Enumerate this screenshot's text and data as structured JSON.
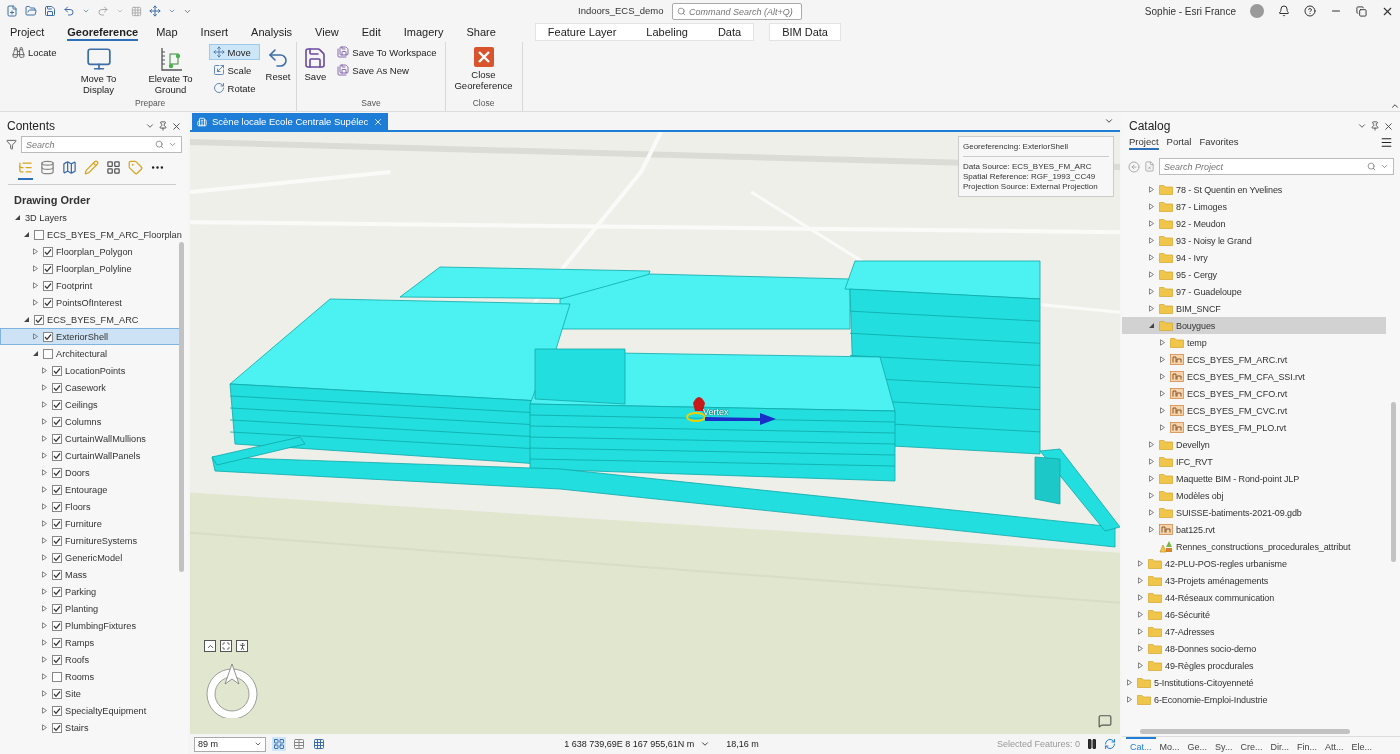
{
  "window": {
    "title": "Indoors_ECS_demo",
    "command_search": {
      "placeholder": "Command Search (Alt+Q)"
    },
    "user": "Sophie - Esri France"
  },
  "ribbon_tabs": [
    {
      "label": "Project",
      "selected": false
    },
    {
      "label": "Georeference",
      "selected": true
    },
    {
      "label": "Map",
      "selected": false
    },
    {
      "label": "Insert",
      "selected": false
    },
    {
      "label": "Analysis",
      "selected": false
    },
    {
      "label": "View",
      "selected": false
    },
    {
      "label": "Edit",
      "selected": false
    },
    {
      "label": "Imagery",
      "selected": false
    },
    {
      "label": "Share",
      "selected": false
    }
  ],
  "contextual_tabs": [
    "Feature Layer",
    "Labeling",
    "Data"
  ],
  "extra_tab": "BIM Data",
  "ribbon_groups": [
    {
      "label": "Prepare",
      "columns": [
        [
          {
            "label": "Locate",
            "kind": "small",
            "selected": false
          }
        ],
        [
          {
            "label": "Move To Display",
            "kind": "large",
            "selected": false
          }
        ],
        [
          {
            "label": "Elevate To Ground",
            "kind": "large",
            "selected": false
          }
        ],
        [
          {
            "label": "Move",
            "kind": "small",
            "selected": true
          },
          {
            "label": "Scale",
            "kind": "small",
            "selected": false
          },
          {
            "label": "Rotate",
            "kind": "small",
            "selected": false
          }
        ],
        [
          {
            "label": "Reset",
            "kind": "large",
            "selected": false
          }
        ]
      ]
    },
    {
      "label": "Save",
      "columns": [
        [
          {
            "label": "Save",
            "kind": "large",
            "selected": false
          }
        ],
        [
          {
            "label": "Save To Workspace",
            "kind": "small",
            "selected": false
          },
          {
            "label": "Save As New",
            "kind": "small",
            "selected": false
          }
        ]
      ]
    },
    {
      "label": "Close",
      "columns": [
        [
          {
            "label": "Close Georeference",
            "kind": "large",
            "selected": false
          }
        ]
      ]
    }
  ],
  "contents": {
    "title": "Contents",
    "search": {
      "placeholder": "Search"
    },
    "heading": "Drawing Order",
    "tree": [
      {
        "label": "3D Layers",
        "expanded": true,
        "selected": false,
        "children": [
          {
            "label": "ECS_BYES_FM_ARC_Floorplan",
            "expanded": true,
            "checked": false,
            "selected": false,
            "children": [
              {
                "label": "Floorplan_Polygon",
                "expanded": false,
                "checked": true,
                "selected": false
              },
              {
                "label": "Floorplan_Polyline",
                "expanded": false,
                "checked": true,
                "selected": false
              },
              {
                "label": "Footprint",
                "expanded": false,
                "checked": true,
                "selected": false
              },
              {
                "label": "PointsOfInterest",
                "expanded": false,
                "checked": true,
                "selected": false
              }
            ]
          },
          {
            "label": "ECS_BYES_FM_ARC",
            "expanded": true,
            "checked": true,
            "selected": false,
            "children": [
              {
                "label": "ExteriorShell",
                "expanded": false,
                "checked": true,
                "selected": true
              },
              {
                "label": "Architectural",
                "expanded": true,
                "checked": false,
                "selected": false,
                "children": [
                  {
                    "label": "LocationPoints",
                    "expanded": false,
                    "checked": true,
                    "selected": false
                  },
                  {
                    "label": "Casework",
                    "expanded": false,
                    "checked": true,
                    "selected": false
                  },
                  {
                    "label": "Ceilings",
                    "expanded": false,
                    "checked": true,
                    "selected": false
                  },
                  {
                    "label": "Columns",
                    "expanded": false,
                    "checked": true,
                    "selected": false
                  },
                  {
                    "label": "CurtainWallMullions",
                    "expanded": false,
                    "checked": true,
                    "selected": false
                  },
                  {
                    "label": "CurtainWallPanels",
                    "expanded": false,
                    "checked": true,
                    "selected": false
                  },
                  {
                    "label": "Doors",
                    "expanded": false,
                    "checked": true,
                    "selected": false
                  },
                  {
                    "label": "Entourage",
                    "expanded": false,
                    "checked": true,
                    "selected": false
                  },
                  {
                    "label": "Floors",
                    "expanded": false,
                    "checked": true,
                    "selected": false
                  },
                  {
                    "label": "Furniture",
                    "expanded": false,
                    "checked": true,
                    "selected": false
                  },
                  {
                    "label": "FurnitureSystems",
                    "expanded": false,
                    "checked": true,
                    "selected": false
                  },
                  {
                    "label": "GenericModel",
                    "expanded": false,
                    "checked": true,
                    "selected": false
                  },
                  {
                    "label": "Mass",
                    "expanded": false,
                    "checked": true,
                    "selected": false
                  },
                  {
                    "label": "Parking",
                    "expanded": false,
                    "checked": true,
                    "selected": false
                  },
                  {
                    "label": "Planting",
                    "expanded": false,
                    "checked": true,
                    "selected": false
                  },
                  {
                    "label": "PlumbingFixtures",
                    "expanded": false,
                    "checked": true,
                    "selected": false
                  },
                  {
                    "label": "Ramps",
                    "expanded": false,
                    "checked": true,
                    "selected": false
                  },
                  {
                    "label": "Roofs",
                    "expanded": false,
                    "checked": true,
                    "selected": false
                  },
                  {
                    "label": "Rooms",
                    "expanded": false,
                    "checked": false,
                    "selected": false
                  },
                  {
                    "label": "Site",
                    "expanded": false,
                    "checked": true,
                    "selected": false
                  },
                  {
                    "label": "SpecialtyEquipment",
                    "expanded": false,
                    "checked": true,
                    "selected": false
                  },
                  {
                    "label": "Stairs",
                    "expanded": false,
                    "checked": true,
                    "selected": false
                  }
                ]
              }
            ]
          }
        ]
      }
    ]
  },
  "map": {
    "tab": {
      "label": "Scène locale Ecole Centrale Supélec",
      "selected": true
    },
    "info_panel": {
      "title": "Georeferencing: ExteriorShell",
      "lines": [
        "Data Source: ECS_BYES_FM_ARC",
        "Spatial Reference: RGF_1993_CC49",
        "Projection Source: External Projection"
      ]
    },
    "vertex_label": "Vertex",
    "status_bar": {
      "scale": "89 m",
      "coordinates": "1 638 739,69E 8 167 955,61N m",
      "elevation": "18,16 m",
      "selected_features": "Selected Features: 0"
    }
  },
  "catalog": {
    "title": "Catalog",
    "tabs": [
      {
        "label": "Project",
        "selected": true
      },
      {
        "label": "Portal",
        "selected": false
      },
      {
        "label": "Favorites",
        "selected": false
      }
    ],
    "search": {
      "placeholder": "Search Project"
    },
    "tree": [
      {
        "children": [
          {
            "children": [
              {
                "label": "78 - St Quentin en Yvelines",
                "kind": "folder",
                "expanded": false,
                "selected": false
              },
              {
                "label": "87 - Limoges",
                "kind": "folder",
                "expanded": false,
                "selected": false
              },
              {
                "label": "92 - Meudon",
                "kind": "folder",
                "expanded": false,
                "selected": false
              },
              {
                "label": "93 - Noisy le Grand",
                "kind": "folder",
                "expanded": false,
                "selected": false
              },
              {
                "label": "94 - Ivry",
                "kind": "folder",
                "expanded": false,
                "selected": false
              },
              {
                "label": "95 - Cergy",
                "kind": "folder",
                "expanded": false,
                "selected": false
              },
              {
                "label": "97 - Guadeloupe",
                "kind": "folder",
                "expanded": false,
                "selected": false
              },
              {
                "label": "BIM_SNCF",
                "kind": "folder",
                "expanded": false,
                "selected": false
              },
              {
                "label": "Bouygues",
                "kind": "folder",
                "expanded": true,
                "selected": true,
                "children": [
                  {
                    "label": "temp",
                    "kind": "folder",
                    "expanded": false,
                    "selected": false
                  },
                  {
                    "label": "ECS_BYES_FM_ARC.rvt",
                    "kind": "revit",
                    "expanded": false,
                    "selected": false
                  },
                  {
                    "label": "ECS_BYES_FM_CFA_SSI.rvt",
                    "kind": "revit",
                    "expanded": false,
                    "selected": false
                  },
                  {
                    "label": "ECS_BYES_FM_CFO.rvt",
                    "kind": "revit",
                    "expanded": false,
                    "selected": false
                  },
                  {
                    "label": "ECS_BYES_FM_CVC.rvt",
                    "kind": "revit",
                    "expanded": false,
                    "selected": false
                  },
                  {
                    "label": "ECS_BYES_FM_PLO.rvt",
                    "kind": "revit",
                    "expanded": false,
                    "selected": false
                  }
                ]
              },
              {
                "label": "Devellyn",
                "kind": "folder",
                "expanded": false,
                "selected": false
              },
              {
                "label": "IFC_RVT",
                "kind": "folder",
                "expanded": false,
                "selected": false
              },
              {
                "label": "Maquette BIM - Rond-point JLP",
                "kind": "folder",
                "expanded": false,
                "selected": false
              },
              {
                "label": "Modèles obj",
                "kind": "folder",
                "expanded": false,
                "selected": false
              },
              {
                "label": "SUISSE-batiments-2021-09.gdb",
                "kind": "folder",
                "expanded": false,
                "selected": false
              },
              {
                "label": "bat125.rvt",
                "kind": "revit",
                "expanded": false,
                "selected": false
              },
              {
                "label": "Rennes_constructions_procedurales_attribut",
                "kind": "layer",
                "selected": false
              }
            ]
          },
          {
            "label": "42-PLU-POS-regles urbanisme",
            "kind": "folder",
            "expanded": false,
            "selected": false
          },
          {
            "label": "43-Projets aménagements",
            "kind": "folder",
            "expanded": false,
            "selected": false
          },
          {
            "label": "44-Réseaux communication",
            "kind": "folder",
            "expanded": false,
            "selected": false
          },
          {
            "label": "46-Sécurité",
            "kind": "folder",
            "expanded": false,
            "selected": false
          },
          {
            "label": "47-Adresses",
            "kind": "folder",
            "expanded": false,
            "selected": false
          },
          {
            "label": "48-Donnes socio-demo",
            "kind": "folder",
            "expanded": false,
            "selected": false
          },
          {
            "label": "49-Règles procdurales",
            "kind": "folder",
            "expanded": false,
            "selected": false
          }
        ]
      },
      {
        "label": "5-Institutions-Citoyenneté",
        "kind": "folder",
        "expanded": false,
        "selected": false
      },
      {
        "label": "6-Economie-Emploi-Industrie",
        "kind": "folder",
        "expanded": false,
        "selected": false
      }
    ],
    "bottom_tabs": [
      {
        "label": "Cat...",
        "selected": true
      },
      {
        "label": "Mo...",
        "selected": false
      },
      {
        "label": "Ge...",
        "selected": false
      },
      {
        "label": "Sy...",
        "selected": false
      },
      {
        "label": "Cre...",
        "selected": false
      },
      {
        "label": "Dir...",
        "selected": false
      },
      {
        "label": "Fin...",
        "selected": false
      },
      {
        "label": "Att...",
        "selected": false
      },
      {
        "label": "Ele...",
        "selected": false
      }
    ]
  }
}
